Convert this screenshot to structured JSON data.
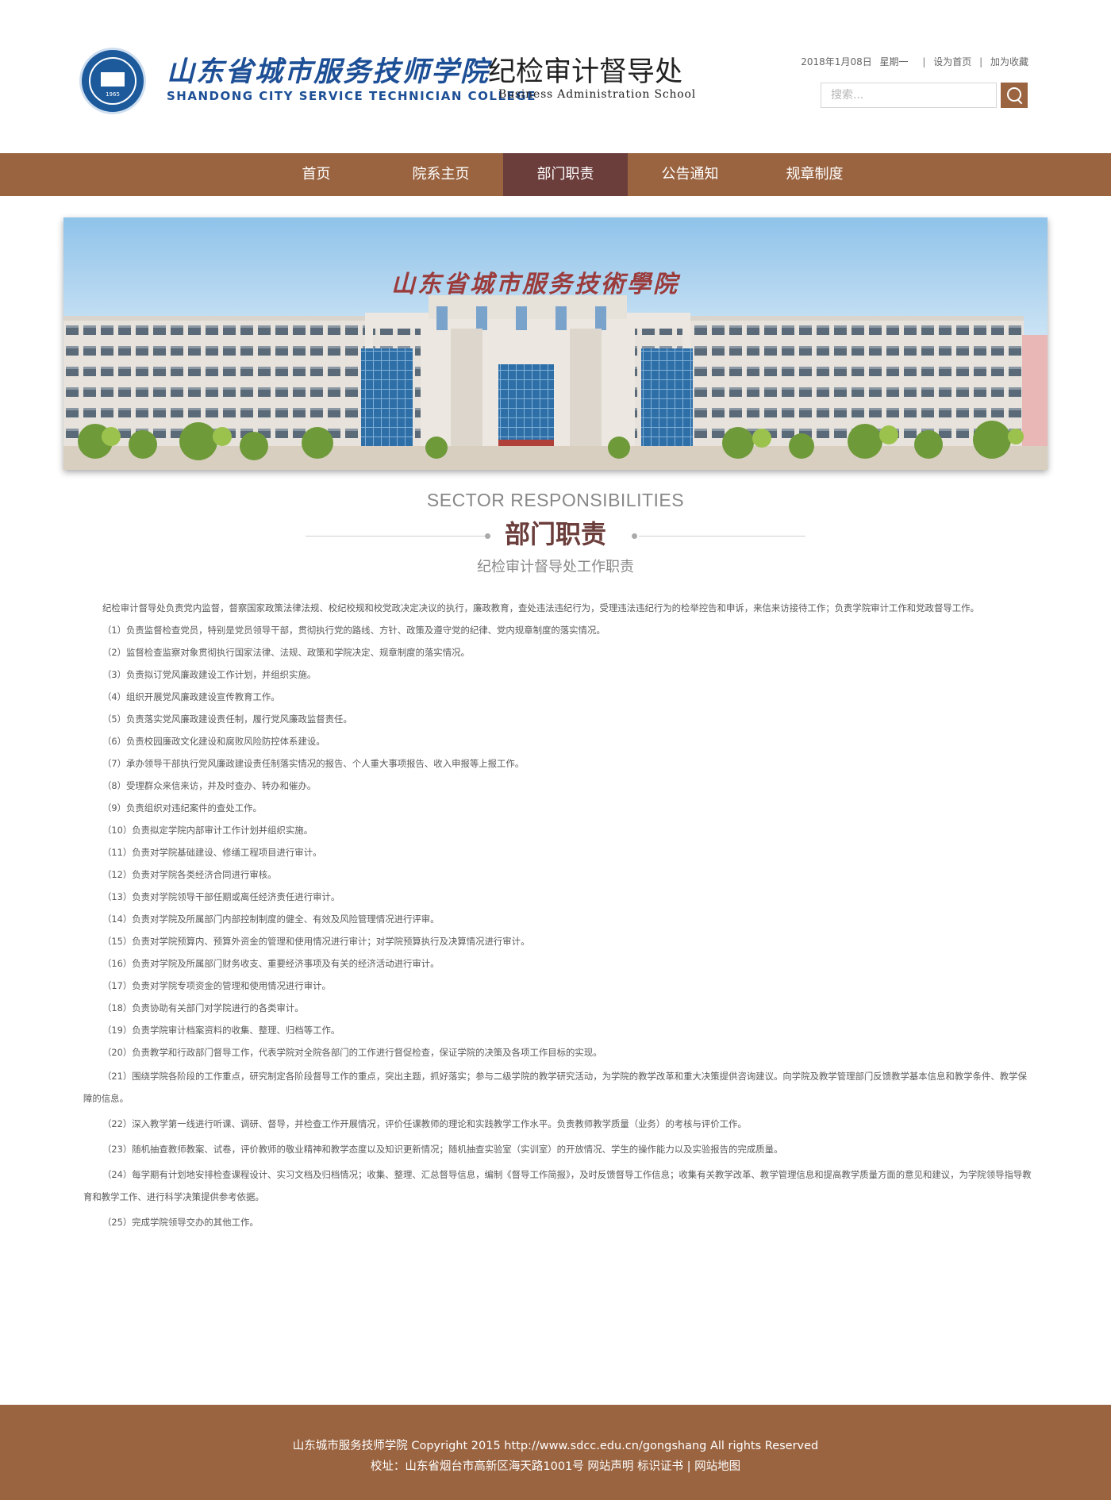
{
  "header": {
    "brand_cn": "山东省城市服务技师学院",
    "brand_en": "SHANDONG CITY SERVICE TECHNICIAN COLLEGE",
    "dept_cn": "纪检审计督导处",
    "dept_en": "Business Administration School",
    "logo_year": "1965",
    "date": "2018年1月08日",
    "weekday": "星期一",
    "set_home": "设为首页",
    "add_fav": "加为收藏",
    "search_placeholder": "搜索..."
  },
  "nav": {
    "items": [
      "首页",
      "院系主页",
      "部门职责",
      "公告通知",
      "规章制度"
    ],
    "active": "部门职责"
  },
  "banner": {
    "sign_text": "山东省城市服务技術學院"
  },
  "section": {
    "title_en": "SECTOR RESPONSIBILITIES",
    "title_cn": "部门职责",
    "subtitle": "纪检审计督导处工作职责"
  },
  "content": {
    "intro": "纪检审计督导处负责党内监督，督察国家政策法律法规、校纪校规和校党政决定决议的执行，廉政教育，查处违法违纪行为，受理违法违纪行为的检举控告和申诉，来信来访接待工作；负责学院审计工作和党政督导工作。",
    "items": [
      "（1）负责监督检查党员，特别是党员领导干部，贯彻执行党的路线、方针、政策及遵守党的纪律、党内规章制度的落实情况。",
      "（2）监督检查监察对象贯彻执行国家法律、法规、政策和学院决定、规章制度的落实情况。",
      "（3）负责拟订党风廉政建设工作计划，并组织实施。",
      "（4）组织开展党风廉政建设宣传教育工作。",
      "（5）负责落实党风廉政建设责任制，履行党风廉政监督责任。",
      "（6）负责校园廉政文化建设和腐败风险防控体系建设。",
      "（7）承办领导干部执行党风廉政建设责任制落实情况的报告、个人重大事项报告、收入申报等上报工作。",
      "（8）受理群众来信来访，并及时查办、转办和催办。",
      "（9）负责组织对违纪案件的查处工作。",
      "（10）负责拟定学院内部审计工作计划并组织实施。",
      "（11）负责对学院基础建设、修缮工程项目进行审计。",
      "（12）负责对学院各类经济合同进行审核。",
      "（13）负责对学院领导干部任期或离任经济责任进行审计。",
      "（14）负责对学院及所属部门内部控制制度的健全、有效及风险管理情况进行评审。",
      "（15）负责对学院预算内、预算外资金的管理和使用情况进行审计；对学院预算执行及决算情况进行审计。",
      "（16）负责对学院及所属部门财务收支、重要经济事项及有关的经济活动进行审计。",
      "（17）负责对学院专项资金的管理和使用情况进行审计。",
      "（18）负责协助有关部门对学院进行的各类审计。",
      "（19）负责学院审计档案资料的收集、整理、归档等工作。",
      "（20）负责教学和行政部门督导工作，代表学院对全院各部门的工作进行督促检查，保证学院的决策及各项工作目标的实现。"
    ],
    "items_long": [
      "（21）围绕学院各阶段的工作重点，研究制定各阶段督导工作的重点，突出主题，抓好落实；参与二级学院的教学研究活动，为学院的教学改革和重大决策提供咨询建议。向学院及教学管理部门反馈教学基本信息和教学条件、教学保障的信息。",
      "（22）深入教学第一线进行听课、调研、督导，并检查工作开展情况，评价任课教师的理论和实践教学工作水平。负责教师教学质量（业务）的考核与评价工作。",
      "（23）随机抽查教师教案、试卷，评价教师的敬业精神和教学态度以及知识更新情况；随机抽查实验室（实训室）的开放情况、学生的操作能力以及实验报告的完成质量。",
      "（24）每学期有计划地安排检查课程设计、实习文档及归档情况；收集、整理、汇总督导信息，编制《督导工作简报》，及时反馈督导工作信息；收集有关教学改革、教学管理信息和提高教学质量方面的意见和建议，为学院领导指导教育和教学工作、进行科学决策提供参考依据。",
      "（25）完成学院领导交办的其他工作。"
    ]
  },
  "footer": {
    "line1": "山东城市服务技师学院 Copyright 2015 http://www.sdcc.edu.cn/gongshang All rights Reserved",
    "address": "校址：山东省烟台市高新区海天路1001号",
    "links": [
      "网站声明",
      "标识证书",
      "网站地图"
    ],
    "sep": "|"
  },
  "colors": {
    "nav_bg": "#9a6441",
    "nav_active": "#6b3e3c",
    "brand_blue": "#1d4f96",
    "footer_bg": "#9a6441"
  }
}
